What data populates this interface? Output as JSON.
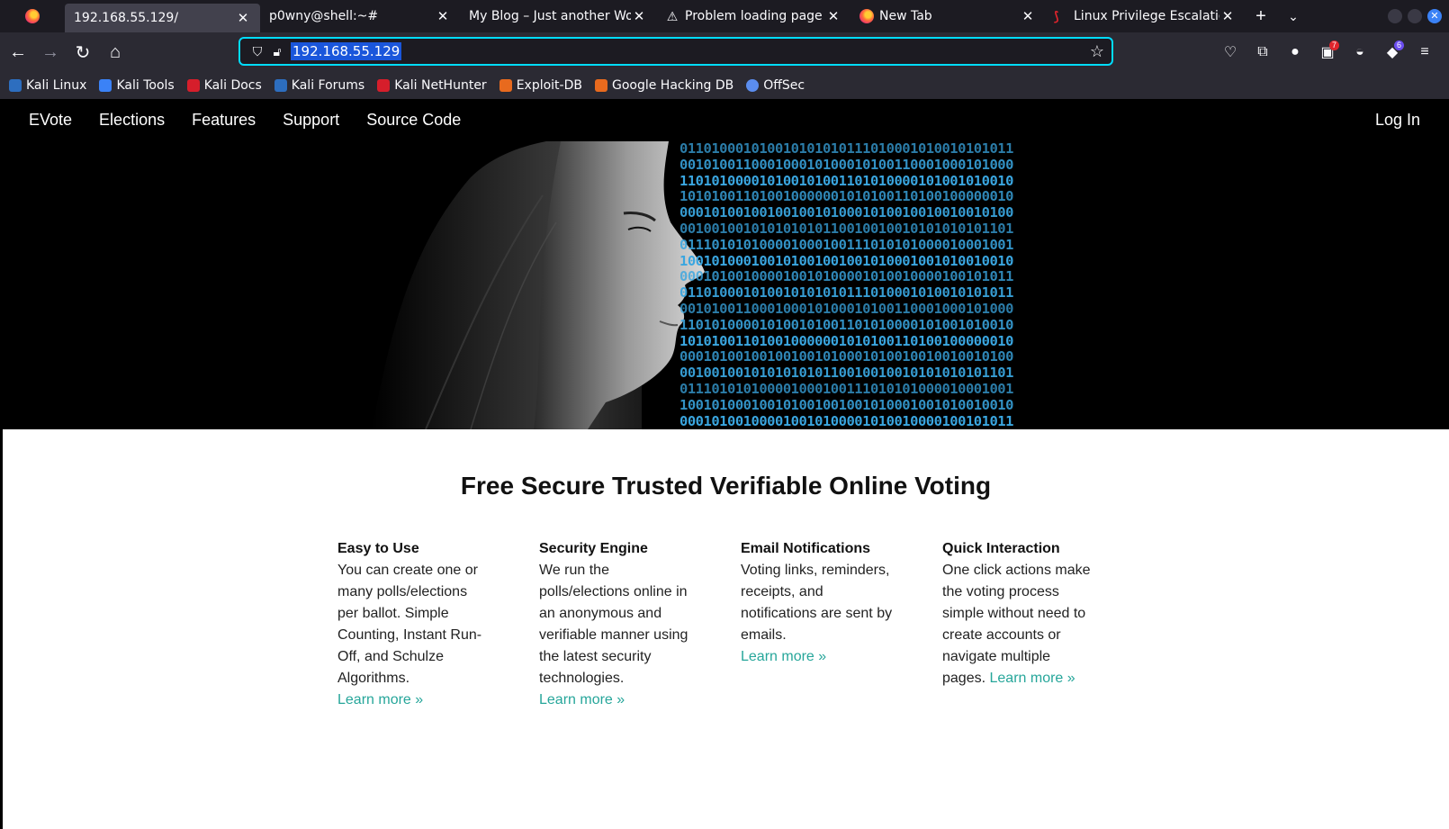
{
  "browser": {
    "tabs": [
      {
        "title": "192.168.55.129/",
        "active": true,
        "favicon": "none"
      },
      {
        "title": "p0wny@shell:~#",
        "active": false,
        "favicon": "none"
      },
      {
        "title": "My Blog – Just another Word",
        "active": false,
        "favicon": "none"
      },
      {
        "title": "Problem loading page",
        "active": false,
        "favicon": "warning-icon"
      },
      {
        "title": "New Tab",
        "active": false,
        "favicon": "firefox-icon"
      },
      {
        "title": "Linux Privilege Escalation",
        "active": false,
        "favicon": "hacktricks-icon"
      }
    ],
    "url": "192.168.55.129",
    "badges": {
      "extension_red": "7",
      "extension_purple": "6"
    },
    "bookmarks": [
      {
        "label": "Kali Linux",
        "color": "#2d6ebf"
      },
      {
        "label": "Kali Tools",
        "color": "#3b82f6"
      },
      {
        "label": "Kali Docs",
        "color": "#d61e2b"
      },
      {
        "label": "Kali Forums",
        "color": "#2d6ebf"
      },
      {
        "label": "Kali NetHunter",
        "color": "#d61e2b"
      },
      {
        "label": "Exploit-DB",
        "color": "#e86a1e"
      },
      {
        "label": "Google Hacking DB",
        "color": "#e86a1e"
      },
      {
        "label": "OffSec",
        "color": "#5b8def"
      }
    ]
  },
  "site": {
    "nav": {
      "brand": "EVote",
      "links": [
        "Elections",
        "Features",
        "Support",
        "Source Code"
      ],
      "login": "Log In"
    },
    "headline": "Free Secure Trusted Verifiable Online Voting",
    "features": [
      {
        "title": "Easy to Use",
        "text": "You can create one or many polls/elections per ballot. Simple Counting, Instant Run-Off, and Schulze Algorithms.",
        "link": "Learn more »"
      },
      {
        "title": "Security Engine",
        "text": "We run the polls/elections online in an anonymous and verifiable manner using the latest security technologies.",
        "link": "Learn more »"
      },
      {
        "title": "Email Notifications",
        "text": "Voting links, reminders, receipts, and notifications are sent by emails.",
        "link": "Learn more »"
      },
      {
        "title": "Quick Interaction",
        "text": "One click actions make the voting process simple without need to create accounts or navigate multiple pages.",
        "link": "Learn more »"
      }
    ],
    "link_color": "#26a69a"
  }
}
